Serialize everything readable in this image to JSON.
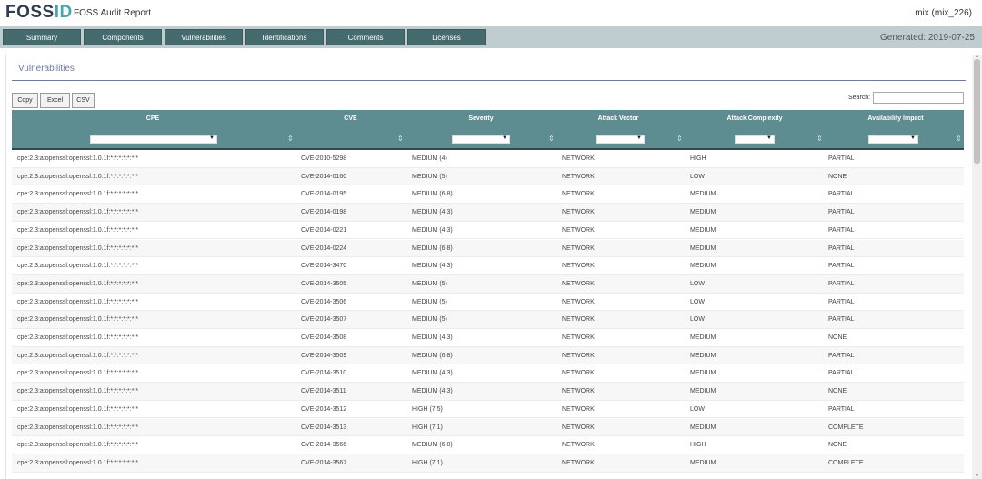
{
  "header": {
    "logo": "FOSSID",
    "title": "FOSS Audit Report",
    "user": "mix (mix_226)"
  },
  "nav": {
    "tabs": [
      "Summary",
      "Components",
      "Vulnerabilities",
      "Identifications",
      "Comments",
      "Licenses"
    ],
    "generated": "Generated: 2019-07-25"
  },
  "panel": {
    "title": "Vulnerabilities",
    "buttons": [
      "Copy",
      "Excel",
      "CSV"
    ],
    "search_label": "Search:"
  },
  "table": {
    "columns": [
      "CPE",
      "CVE",
      "Severity",
      "Attack Vector",
      "Attack Complexity",
      "Availability Impact"
    ],
    "rows": [
      [
        "cpe:2.3:a:openssl:openssl:1.0.1f:*:*:*:*:*:*:*",
        "CVE-2010-5298",
        "MEDIUM (4)",
        "NETWORK",
        "HIGH",
        "PARTIAL"
      ],
      [
        "cpe:2.3:a:openssl:openssl:1.0.1f:*:*:*:*:*:*:*",
        "CVE-2014-0160",
        "MEDIUM (5)",
        "NETWORK",
        "LOW",
        "NONE"
      ],
      [
        "cpe:2.3:a:openssl:openssl:1.0.1f:*:*:*:*:*:*:*",
        "CVE-2014-0195",
        "MEDIUM (6.8)",
        "NETWORK",
        "MEDIUM",
        "PARTIAL"
      ],
      [
        "cpe:2.3:a:openssl:openssl:1.0.1f:*:*:*:*:*:*:*",
        "CVE-2014-0198",
        "MEDIUM (4.3)",
        "NETWORK",
        "MEDIUM",
        "PARTIAL"
      ],
      [
        "cpe:2.3:a:openssl:openssl:1.0.1f:*:*:*:*:*:*:*",
        "CVE-2014-0221",
        "MEDIUM (4.3)",
        "NETWORK",
        "MEDIUM",
        "PARTIAL"
      ],
      [
        "cpe:2.3:a:openssl:openssl:1.0.1f:*:*:*:*:*:*:*",
        "CVE-2014-0224",
        "MEDIUM (6.8)",
        "NETWORK",
        "MEDIUM",
        "PARTIAL"
      ],
      [
        "cpe:2.3:a:openssl:openssl:1.0.1f:*:*:*:*:*:*:*",
        "CVE-2014-3470",
        "MEDIUM (4.3)",
        "NETWORK",
        "MEDIUM",
        "PARTIAL"
      ],
      [
        "cpe:2.3:a:openssl:openssl:1.0.1f:*:*:*:*:*:*:*",
        "CVE-2014-3505",
        "MEDIUM (5)",
        "NETWORK",
        "LOW",
        "PARTIAL"
      ],
      [
        "cpe:2.3:a:openssl:openssl:1.0.1f:*:*:*:*:*:*:*",
        "CVE-2014-3506",
        "MEDIUM (5)",
        "NETWORK",
        "LOW",
        "PARTIAL"
      ],
      [
        "cpe:2.3:a:openssl:openssl:1.0.1f:*:*:*:*:*:*:*",
        "CVE-2014-3507",
        "MEDIUM (5)",
        "NETWORK",
        "LOW",
        "PARTIAL"
      ],
      [
        "cpe:2.3:a:openssl:openssl:1.0.1f:*:*:*:*:*:*:*",
        "CVE-2014-3508",
        "MEDIUM (4.3)",
        "NETWORK",
        "MEDIUM",
        "NONE"
      ],
      [
        "cpe:2.3:a:openssl:openssl:1.0.1f:*:*:*:*:*:*:*",
        "CVE-2014-3509",
        "MEDIUM (6.8)",
        "NETWORK",
        "MEDIUM",
        "PARTIAL"
      ],
      [
        "cpe:2.3:a:openssl:openssl:1.0.1f:*:*:*:*:*:*:*",
        "CVE-2014-3510",
        "MEDIUM (4.3)",
        "NETWORK",
        "MEDIUM",
        "PARTIAL"
      ],
      [
        "cpe:2.3:a:openssl:openssl:1.0.1f:*:*:*:*:*:*:*",
        "CVE-2014-3511",
        "MEDIUM (4.3)",
        "NETWORK",
        "MEDIUM",
        "NONE"
      ],
      [
        "cpe:2.3:a:openssl:openssl:1.0.1f:*:*:*:*:*:*:*",
        "CVE-2014-3512",
        "HIGH (7.5)",
        "NETWORK",
        "LOW",
        "PARTIAL"
      ],
      [
        "cpe:2.3:a:openssl:openssl:1.0.1f:*:*:*:*:*:*:*",
        "CVE-2014-3513",
        "HIGH (7.1)",
        "NETWORK",
        "MEDIUM",
        "COMPLETE"
      ],
      [
        "cpe:2.3:a:openssl:openssl:1.0.1f:*:*:*:*:*:*:*",
        "CVE-2014-3566",
        "MEDIUM (6.8)",
        "NETWORK",
        "HIGH",
        "NONE"
      ],
      [
        "cpe:2.3:a:openssl:openssl:1.0.1f:*:*:*:*:*:*:*",
        "CVE-2014-3567",
        "HIGH (7.1)",
        "NETWORK",
        "MEDIUM",
        "COMPLETE"
      ]
    ]
  },
  "colors": {
    "header_bg": "#5d8c91",
    "nav_tab_bg": "#466b6e",
    "nav_bar_bg": "#bfcdd0",
    "title_accent": "#6f77a5",
    "logo_accent": "#45a8a8"
  }
}
